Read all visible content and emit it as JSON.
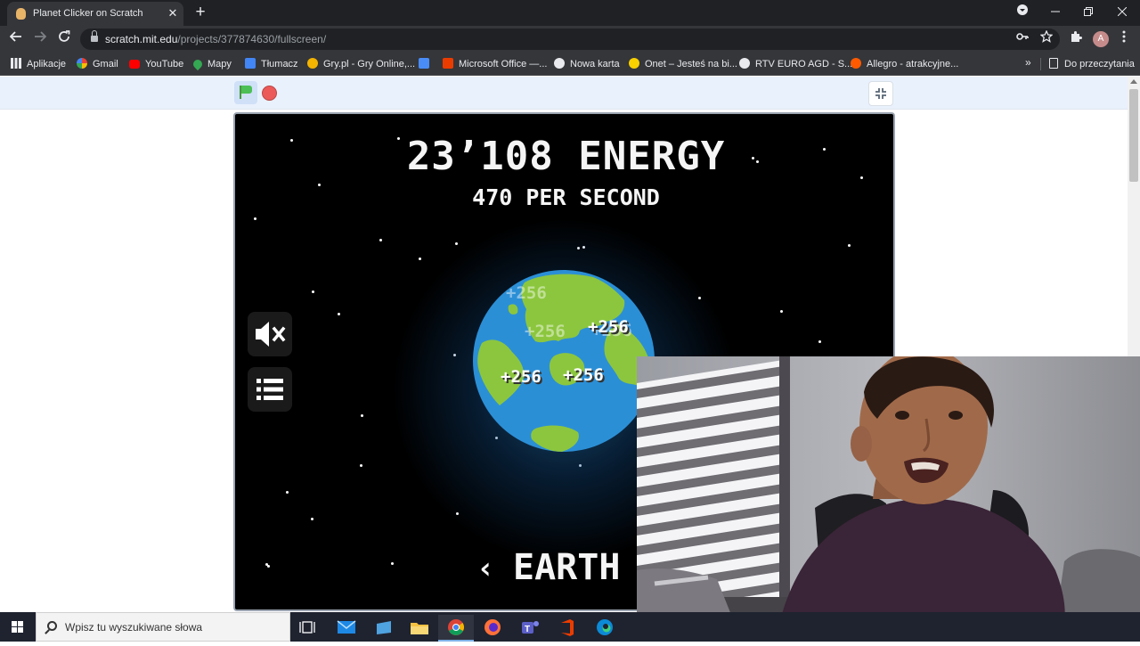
{
  "browser": {
    "tab_title": "Planet Clicker on Scratch",
    "tab_close": "✕",
    "new_tab": "+",
    "url_host": "scratch.mit.edu",
    "url_path": "/projects/377874630/fullscreen/",
    "avatar_letter": "A",
    "bookmarks": [
      {
        "label": "Aplikacje",
        "icon": "apps-grid-icon",
        "color": "#e8eaed"
      },
      {
        "label": "Gmail",
        "icon": "google-icon",
        "color": "#ffffff"
      },
      {
        "label": "YouTube",
        "icon": "youtube-icon",
        "color": "#ff0000"
      },
      {
        "label": "Mapy",
        "icon": "maps-pin-icon",
        "color": "#34a853"
      },
      {
        "label": "Tłumacz",
        "icon": "translate-icon",
        "color": "#4285f4"
      },
      {
        "label": "Gry.pl - Gry Online,...",
        "icon": "gry-icon",
        "color": "#f4b400"
      },
      {
        "label": "",
        "icon": "puzzle-bookmark-icon",
        "color": "#4a8cf7"
      },
      {
        "label": "Microsoft Office —...",
        "icon": "office-icon",
        "color": "#eb3c00"
      },
      {
        "label": "Nowa karta",
        "icon": "globe-icon",
        "color": "#e8eaed"
      },
      {
        "label": "Onet – Jesteś na bi...",
        "icon": "onet-icon",
        "color": "#f9d000"
      },
      {
        "label": "RTV EURO AGD - S...",
        "icon": "globe-icon",
        "color": "#e8eaed"
      },
      {
        "label": "Allegro - atrakcyjne...",
        "icon": "allegro-icon",
        "color": "#ff5a00"
      }
    ],
    "bookmarks_more": "»",
    "reading_list": "Do przeczytania"
  },
  "game": {
    "energy_title": "23’108 ENERGY",
    "per_second": "470 PER SECOND",
    "click_value": "+256",
    "prev_arrow": "‹",
    "planet_name": "EARTH"
  },
  "taskbar": {
    "search_placeholder": "Wpisz tu wyszukiwane słowa"
  },
  "colors": {
    "ocean": "#2b8fd6",
    "land": "#8cc63e",
    "stage_bg": "#000000",
    "controlbar_bg": "#e9f1fc"
  }
}
